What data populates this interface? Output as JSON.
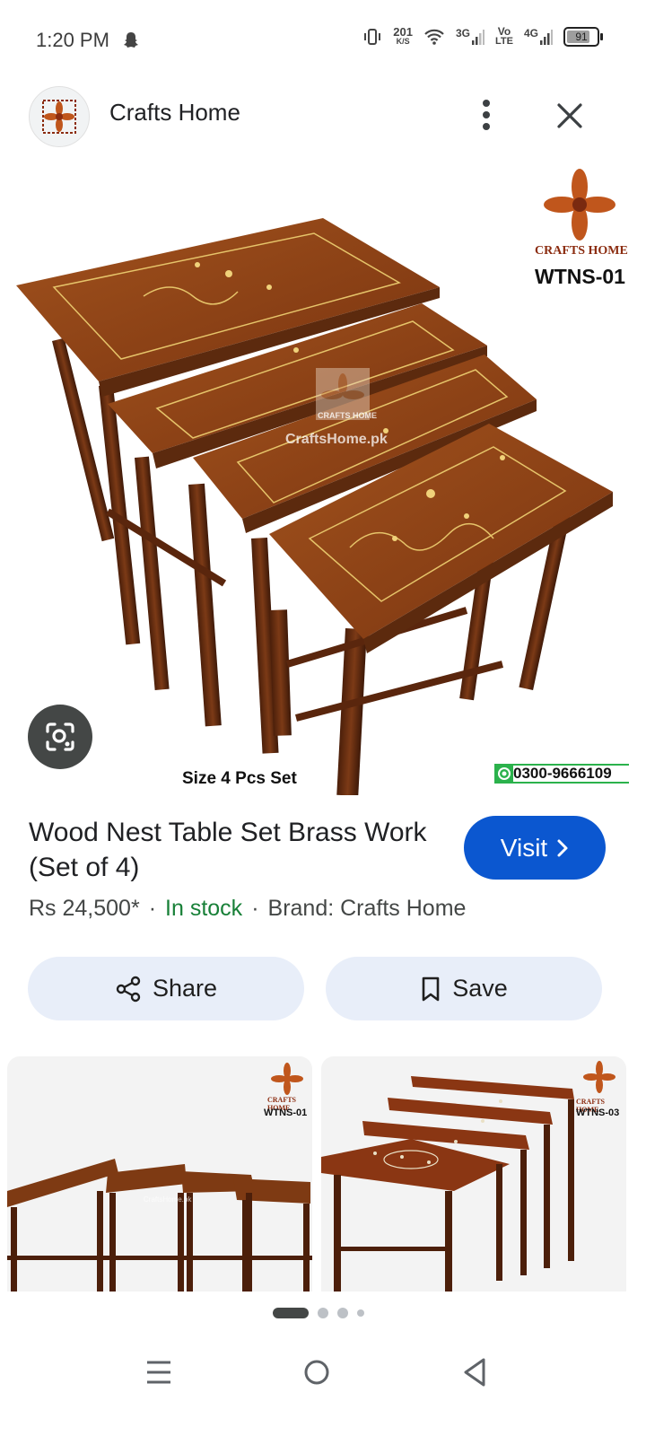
{
  "status_bar": {
    "time": "1:20 PM",
    "net_speed_value": "201",
    "net_speed_unit": "K/S",
    "net_3g": "3G",
    "volte_top": "Vo",
    "volte_bottom": "LTE",
    "net_4g": "4G",
    "battery_level": "91",
    "battery_fraction": 0.91
  },
  "header": {
    "site_name": "Crafts Home"
  },
  "image": {
    "brand_logo_text": "CRAFTS HOME",
    "product_code": "WTNS-01",
    "watermark_text": "CraftsHome.pk",
    "watermark_logo_text": "CRAFTS HOME",
    "size_caption": "Size 4 Pcs Set",
    "phone": "0300-9666109"
  },
  "product": {
    "title": "Wood Nest Table Set Brass Work (Set of 4)",
    "price": "Rs 24,500*",
    "stock": "In stock",
    "brand": "Brand: Crafts Home",
    "visit_label": "Visit"
  },
  "actions": {
    "share_label": "Share",
    "save_label": "Save"
  },
  "thumbnails": [
    {
      "logo_text": "CRAFTS HOME",
      "code": "WTNS-01",
      "watermark": "CraftsHome.pk"
    },
    {
      "logo_text": "CRAFTS HOME",
      "code": "WTNS-03"
    }
  ],
  "colors": {
    "accent": "#0b57d0",
    "in_stock": "#188038",
    "pill_bg": "#e8eef9",
    "wood": "#8a3f12"
  }
}
